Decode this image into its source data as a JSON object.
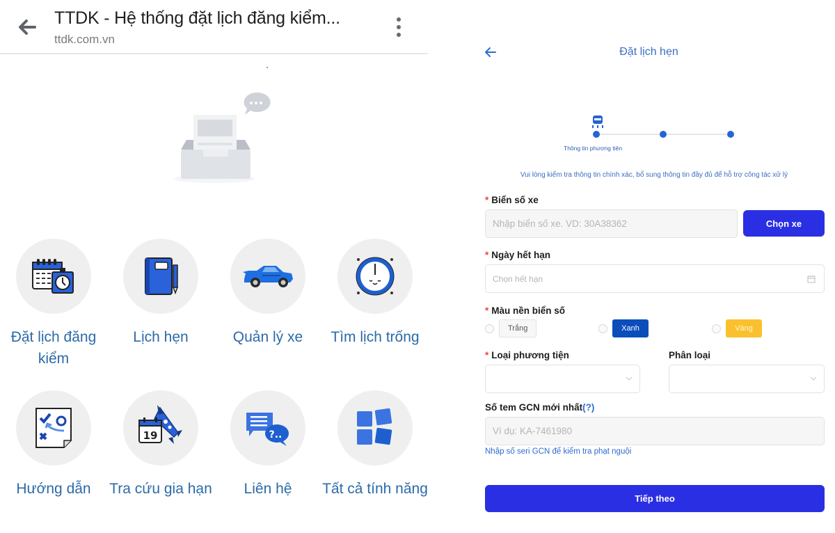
{
  "left": {
    "header": {
      "title": "TTDK - Hệ thống đặt lịch đăng kiểm...",
      "url": "ttdk.com.vn",
      "back_icon": "arrow-left-icon",
      "menu_icon": "more-vertical-icon"
    },
    "empty_illustration": "empty-inbox-illustration",
    "features": [
      {
        "label": "Đặt lịch đăng kiểm",
        "icon": "calendar-clock-icon"
      },
      {
        "label": "Lịch hẹn",
        "icon": "notebook-pencil-icon"
      },
      {
        "label": "Quản lý xe",
        "icon": "car-icon"
      },
      {
        "label": "Tìm lịch trống",
        "icon": "stopwatch-icon"
      },
      {
        "label": "Hướng dẫn",
        "icon": "guide-map-icon"
      },
      {
        "label": "Tra cứu gia hạn",
        "icon": "calendar-rocket-icon",
        "calendar_day": "19"
      },
      {
        "label": "Liên hệ",
        "icon": "chat-question-icon",
        "question_text": "?.."
      },
      {
        "label": "Tất cả tính năng",
        "icon": "all-features-grid-icon"
      }
    ]
  },
  "right": {
    "header": {
      "title": "Đặt lịch hẹn",
      "back_icon": "arrow-left-icon"
    },
    "stepper": {
      "current_step": 1,
      "total_steps": 3,
      "current_label": "Thông tin phương tiện",
      "icon": "vehicle-icon"
    },
    "notice": "Vui lòng kiểm tra thông tin chính xác, bổ sung thông tin đầy đủ để hỗ trợ công tác xử lý",
    "fields": {
      "plate": {
        "label": "Biển số xe",
        "required": "*",
        "placeholder": "Nhập biển số xe. VD: 30A38362",
        "value": "",
        "button": "Chọn xe"
      },
      "expiry": {
        "label": "Ngày hết hạn",
        "required": "*",
        "placeholder": "Chọn hết hạn",
        "icon": "calendar-icon"
      },
      "plate_color": {
        "label": "Màu nền biển số",
        "required": "*",
        "options": [
          {
            "label": "Trắng",
            "color": "#f7f7f7",
            "selected": false
          },
          {
            "label": "Xanh",
            "color": "#0b4dbb",
            "selected": false
          },
          {
            "label": "Vàng",
            "color": "#fbc02d",
            "selected": false
          }
        ]
      },
      "vehicle_type": {
        "label": "Loại phương tiện",
        "required": "*",
        "value": ""
      },
      "category": {
        "label": "Phân loại",
        "value": ""
      },
      "gcn": {
        "label": "Số tem GCN mới nhất",
        "help": "(?)",
        "placeholder": "Ví dụ: KA-7461980",
        "hint_link": "Nhập số seri GCN để kiểm tra phạt nguội"
      }
    },
    "submit": "Tiếp theo"
  },
  "colors": {
    "primary_button": "#2b2fe3",
    "link_blue": "#2c6aa8",
    "required_red": "#e8453c"
  }
}
